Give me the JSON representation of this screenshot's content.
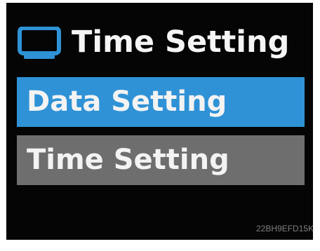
{
  "header": {
    "icon": "monitor-icon",
    "title": "Time Setting"
  },
  "menu": {
    "items": [
      {
        "label": "Data Setting",
        "selected": true
      },
      {
        "label": "Time Setting",
        "selected": false
      }
    ]
  },
  "colors": {
    "screen_background": "#050505",
    "selected_item": "#2f92d6",
    "unselected_item": "#6e6e6e",
    "text": "#f3f3f3"
  },
  "watermark": "22BH9EFD15K"
}
